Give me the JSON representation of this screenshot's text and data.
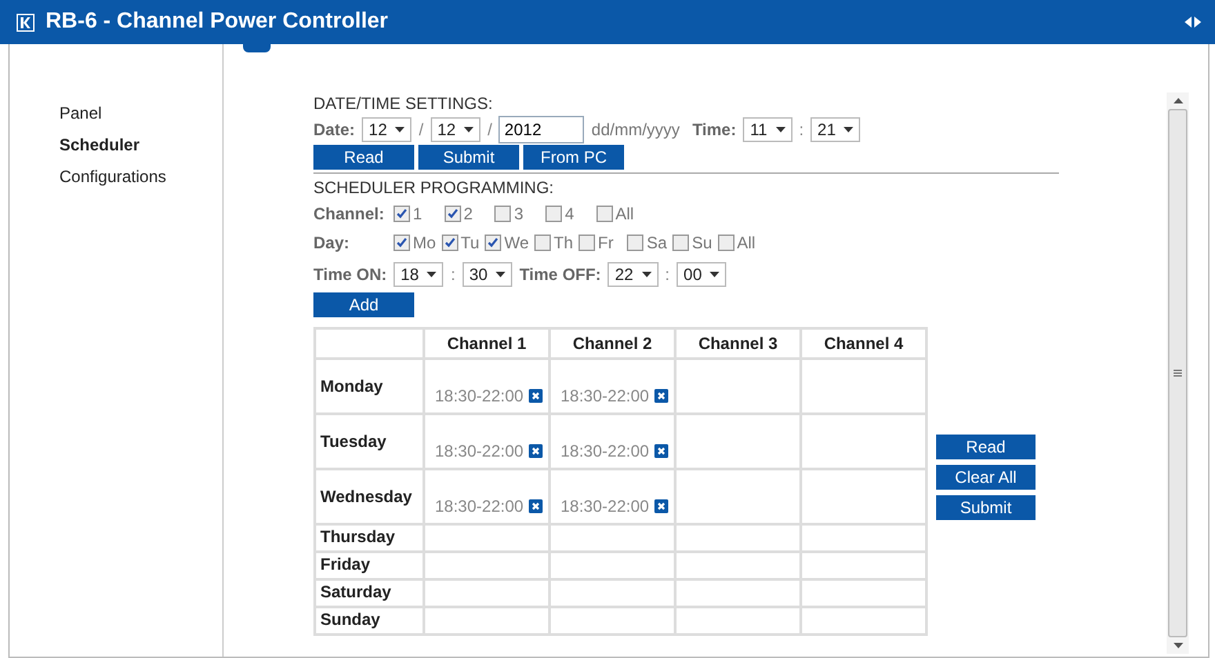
{
  "window": {
    "title": "RB-6 - Channel Power Controller"
  },
  "sidebar": {
    "items": [
      {
        "label": "Panel",
        "selected": false
      },
      {
        "label": "Scheduler",
        "selected": true
      },
      {
        "label": "Configurations",
        "selected": false
      }
    ]
  },
  "date_time": {
    "heading": "DATE/TIME SETTINGS:",
    "date_label": "Date:",
    "day": "12",
    "month": "12",
    "separator": "/",
    "year": "2012",
    "format_hint": "dd/mm/yyyy",
    "time_label": "Time:",
    "hour": "11",
    "time_separator": ":",
    "minute": "21",
    "buttons": [
      "Read",
      "Submit",
      "From PC"
    ]
  },
  "scheduler": {
    "heading": "SCHEDULER PROGRAMMING:",
    "channel_label": "Channel:",
    "channels": [
      {
        "label": "1",
        "checked": true
      },
      {
        "label": "2",
        "checked": true
      },
      {
        "label": "3",
        "checked": false
      },
      {
        "label": "4",
        "checked": false
      },
      {
        "label": "All",
        "checked": false
      }
    ],
    "day_label": "Day:",
    "days": [
      {
        "label": "Mo",
        "checked": true
      },
      {
        "label": "Tu",
        "checked": true
      },
      {
        "label": "We",
        "checked": true
      },
      {
        "label": "Th",
        "checked": false
      },
      {
        "label": "Fr",
        "checked": false
      },
      {
        "label": "Sa",
        "checked": false
      },
      {
        "label": "Su",
        "checked": false
      },
      {
        "label": "All",
        "checked": false
      }
    ],
    "time_on_label": "Time ON:",
    "on_hour": "18",
    "on_minute": "30",
    "time_off_label": "Time OFF:",
    "off_hour": "22",
    "off_minute": "00",
    "separator": ":",
    "add_button": "Add"
  },
  "table": {
    "columns": [
      "Channel 1",
      "Channel 2",
      "Channel 3",
      "Channel 4"
    ],
    "rows": [
      {
        "day": "Monday",
        "cells": [
          "18:30-22:00",
          "18:30-22:00",
          null,
          null
        ]
      },
      {
        "day": "Tuesday",
        "cells": [
          "18:30-22:00",
          "18:30-22:00",
          null,
          null
        ]
      },
      {
        "day": "Wednesday",
        "cells": [
          "18:30-22:00",
          "18:30-22:00",
          null,
          null
        ]
      },
      {
        "day": "Thursday",
        "cells": [
          null,
          null,
          null,
          null
        ]
      },
      {
        "day": "Friday",
        "cells": [
          null,
          null,
          null,
          null
        ]
      },
      {
        "day": "Saturday",
        "cells": [
          null,
          null,
          null,
          null
        ]
      },
      {
        "day": "Sunday",
        "cells": [
          null,
          null,
          null,
          null
        ]
      }
    ]
  },
  "side_buttons": [
    "Read",
    "Clear All",
    "Submit"
  ]
}
